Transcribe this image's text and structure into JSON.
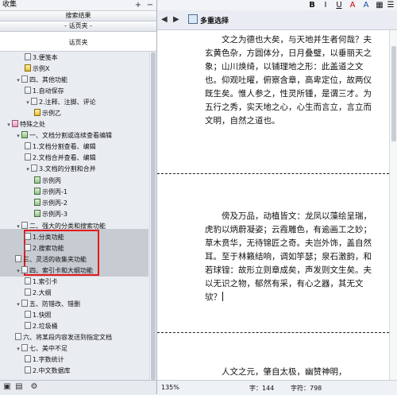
{
  "left_panel": {
    "title": "收集",
    "search_header": "搜索结果",
    "page_header": "- 话页夹 -",
    "tab": "话页夹",
    "tree": [
      {
        "label": "3.便笺本",
        "indent": 2,
        "icon": "note"
      },
      {
        "label": "示例X",
        "indent": 2,
        "icon": "yellow"
      },
      {
        "label": "四、其他功能",
        "indent": 1,
        "icon": "note",
        "twisty": "▾"
      },
      {
        "label": "1.自动保存",
        "indent": 2,
        "icon": "note"
      },
      {
        "label": "2.注释、注脚、评论",
        "indent": 2,
        "icon": "note",
        "twisty": "▾"
      },
      {
        "label": "示例乙",
        "indent": 3,
        "icon": "yellow"
      },
      {
        "label": "特殊之处",
        "indent": 0,
        "icon": "pink",
        "twisty": "▾"
      },
      {
        "label": "一、文档分割或连续查看编辑",
        "indent": 1,
        "icon": "green",
        "twisty": "▾"
      },
      {
        "label": "1.文档分割查看、编辑",
        "indent": 2,
        "icon": "note"
      },
      {
        "label": "2.文档合并查看、编辑",
        "indent": 2,
        "icon": "note"
      },
      {
        "label": "3.文档的分割和合并",
        "indent": 2,
        "icon": "note",
        "twisty": "▾"
      },
      {
        "label": "示例丙",
        "indent": 3,
        "icon": "green"
      },
      {
        "label": "示例丙-1",
        "indent": 3,
        "icon": "green"
      },
      {
        "label": "示例丙-2",
        "indent": 3,
        "icon": "green"
      },
      {
        "label": "示例丙-3",
        "indent": 3,
        "icon": "green"
      },
      {
        "label": "二、强大的分类和搜索功能",
        "indent": 1,
        "icon": "note",
        "twisty": "▾"
      },
      {
        "label": "1.分类功能",
        "indent": 2,
        "icon": "note"
      },
      {
        "label": "2.搜索功能",
        "indent": 2,
        "icon": "note"
      },
      {
        "label": "三、灵活的收集夹功能",
        "indent": 1,
        "icon": "note"
      },
      {
        "label": "四、索引卡和大纲功能",
        "indent": 1,
        "icon": "note",
        "twisty": "▾"
      },
      {
        "label": "1.索引卡",
        "indent": 2,
        "icon": "note"
      },
      {
        "label": "2.大纲",
        "indent": 2,
        "icon": "note"
      },
      {
        "label": "五、防错改、错删",
        "indent": 1,
        "icon": "note",
        "twisty": "▾"
      },
      {
        "label": "1.快照",
        "indent": 2,
        "icon": "note"
      },
      {
        "label": "2.垃圾桶",
        "indent": 2,
        "icon": "note"
      },
      {
        "label": "六、将某段内容发送到指定文档",
        "indent": 1,
        "icon": "note"
      },
      {
        "label": "七、美中不足",
        "indent": 1,
        "icon": "note",
        "twisty": "▾"
      },
      {
        "label": "1.字数统计",
        "indent": 2,
        "icon": "note"
      },
      {
        "label": "2.中文数据库",
        "indent": 2,
        "icon": "note"
      }
    ]
  },
  "toolbar": {
    "bold": "B",
    "italic": "I",
    "underline": "U",
    "strike": "A",
    "style": "A"
  },
  "document": {
    "tab_title": "多重选择",
    "paragraphs": [
      "文之为德也大矣，与天地并生者何哉？夫玄黄色杂，方圆体分，日月叠璧，以垂丽天之象；山川焕绮，以铺理地之形：此盖道之文也。仰观吐曜，俯察含章，高卑定位，故两仪既生矣。惟人参之，性灵所锺，是谓三才。为五行之秀，实天地之心，心生而言立，言立而文明，自然之道也。",
      "傍及万品，动植皆文：龙凤以藻绘呈瑞，虎豹以炳蔚凝姿；云霞雕色，有逾画工之妙；草木贲华，无待锦匠之奇。夫岂外饰，盖自然耳。至于林籁结响，调如竽瑟；泉石激韵，和若球锽：故形立则章成矣，声发则文生矣。夫以无识之物，郁然有采，有心之器，其无文欤？",
      "人文之元，肇自太极，幽赞神明，"
    ]
  },
  "status": {
    "zoom": "135%",
    "words": "字：144",
    "chars": "字符：798"
  }
}
